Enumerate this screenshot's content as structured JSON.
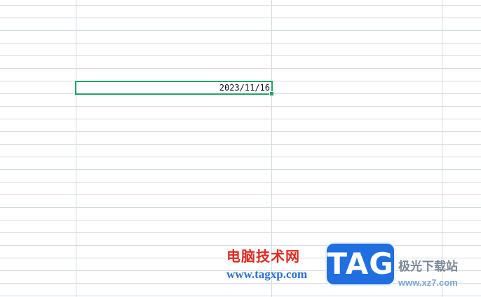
{
  "spreadsheet": {
    "selected_cell_value": "2023/11/16"
  },
  "watermark": {
    "cn_title": "电脑技术网",
    "url": "www.tagxp.com",
    "logo_text": "TAG",
    "site_name": "极光下载站",
    "site_url": "www.xz7.com",
    "colors": {
      "cn_title": "#e02b20",
      "url": "#2a6fd6",
      "logo_bg": "#1f6fe0",
      "site_name": "#7a8796",
      "site_url": "#7aa7d8"
    }
  },
  "theme": {
    "grid_line": "#d5dbe2",
    "selection_border": "#21a366"
  }
}
